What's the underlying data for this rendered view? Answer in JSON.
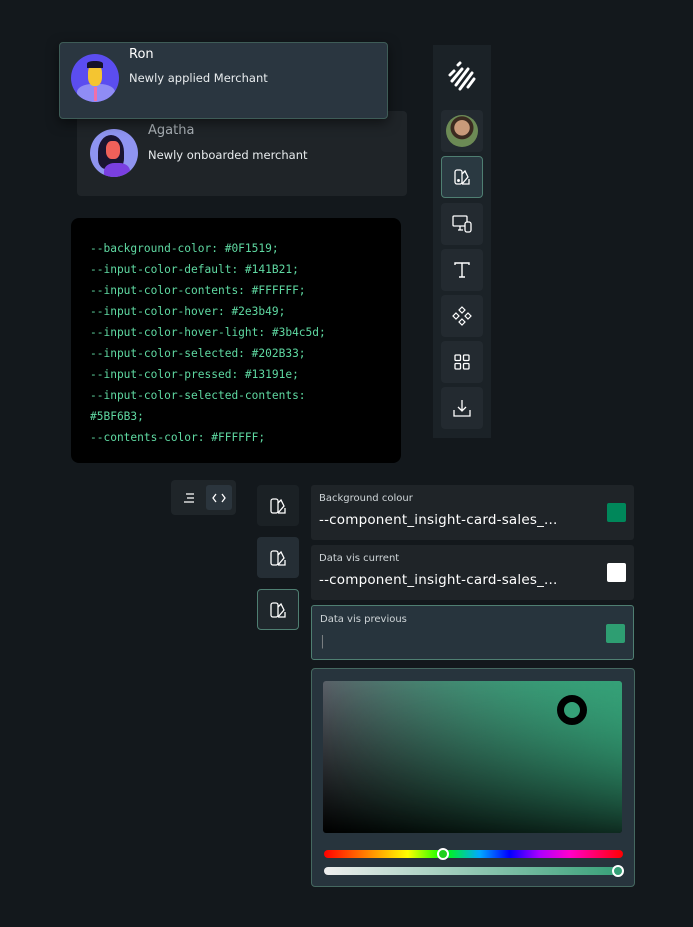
{
  "notifications": [
    {
      "name": "Ron",
      "subtitle": "Newly applied Merchant"
    },
    {
      "name": "Agatha",
      "subtitle": "Newly onboarded merchant"
    }
  ],
  "code_lines": [
    "--background-color: #0F1519;",
    "--input-color-default: #141B21;",
    "--input-color-contents: #FFFFFF;",
    "--input-color-hover: #2e3b49;",
    "--input-color-hover-light: #3b4c5d;",
    "--input-color-selected: #202B33;",
    "--input-color-pressed: #13191e;",
    "--input-color-selected-contents:",
    "#5BF6B3;",
    "--contents-color: #FFFFFF;"
  ],
  "sidebar": {
    "items": [
      "avatar",
      "swatch",
      "devices",
      "text",
      "components",
      "grid",
      "download"
    ],
    "selected": "swatch"
  },
  "toggle": {
    "options": [
      "list",
      "code"
    ],
    "selected": "code"
  },
  "fields": [
    {
      "label": "Background colour",
      "value": "--component_insight-card-sales_...",
      "color": "#00875A"
    },
    {
      "label": "Data vis current",
      "value": "--component_insight-card-sales_...",
      "color": "#FFFFFF"
    },
    {
      "label": "Data vis previous",
      "value": "|",
      "color": "#2E9E72"
    }
  ],
  "picker": {
    "hue_fraction": 0.4,
    "alpha_fraction": 1.0,
    "color": "#35A077"
  }
}
